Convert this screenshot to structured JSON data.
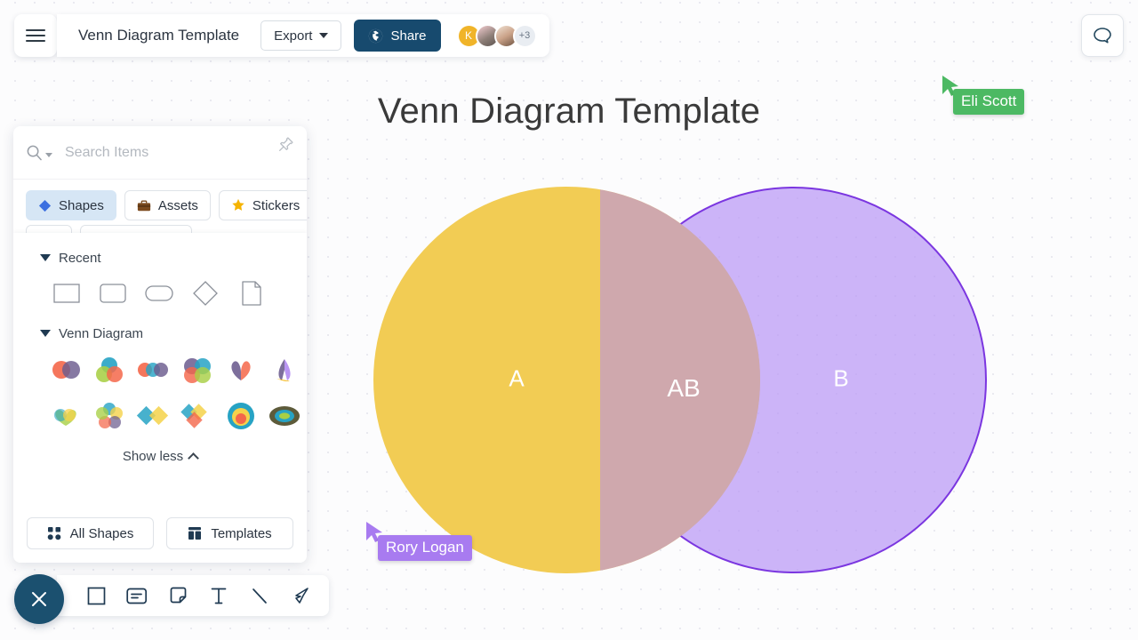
{
  "header": {
    "menu_icon": "hamburger-menu-icon",
    "doc_title": "Venn Diagram Template",
    "export_label": "Export",
    "share_label": "Share",
    "share_icon": "globe-icon",
    "comment_icon": "speech-bubble-icon",
    "avatars": [
      {
        "name": "avatar-k",
        "initial": "K",
        "kind": "initial"
      },
      {
        "name": "avatar-photo-1",
        "initial": "",
        "kind": "photo"
      },
      {
        "name": "avatar-photo-2",
        "initial": "",
        "kind": "photo"
      },
      {
        "name": "avatar-overflow",
        "initial": "+3",
        "kind": "count"
      }
    ],
    "colors": {
      "share_bg": "#174a6e",
      "avatar_k_bg": "#f0b429"
    }
  },
  "panel": {
    "search": {
      "placeholder": "Search Items",
      "value": "",
      "icon": "search-icon",
      "pin_icon": "pin-icon"
    },
    "tabs": [
      {
        "label": "Shapes",
        "icon": "blue-diamond-icon",
        "active": true
      },
      {
        "label": "Assets",
        "icon": "briefcase-icon",
        "active": false
      },
      {
        "label": "Stickers",
        "icon": "star-icon",
        "active": false
      }
    ],
    "groups": [
      {
        "title": "Recent",
        "items": [
          {
            "name": "rectangle-shape"
          },
          {
            "name": "rounded-rectangle-shape"
          },
          {
            "name": "pill-shape"
          },
          {
            "name": "diamond-shape"
          },
          {
            "name": "document-shape"
          }
        ]
      },
      {
        "title": "Venn Diagram",
        "items": [
          {
            "name": "venn-2-circle"
          },
          {
            "name": "venn-3-circle"
          },
          {
            "name": "venn-3-inline"
          },
          {
            "name": "venn-4-circle"
          },
          {
            "name": "venn-2-petal"
          },
          {
            "name": "venn-3-petal"
          },
          {
            "name": "venn-heart-3"
          },
          {
            "name": "venn-flower-6"
          },
          {
            "name": "venn-2-diamond"
          },
          {
            "name": "venn-3-diamond"
          },
          {
            "name": "venn-concentric-circle"
          },
          {
            "name": "venn-concentric-oval"
          }
        ]
      }
    ],
    "show_less_label": "Show less",
    "footer": [
      {
        "label": "All Shapes",
        "icon": "grid-dots-icon"
      },
      {
        "label": "Templates",
        "icon": "layout-icon"
      }
    ]
  },
  "canvas": {
    "board_title": "Venn Diagram Template",
    "venn": {
      "circle_a": {
        "label": "A",
        "fill": "#f2cc54"
      },
      "circle_b": {
        "label": "B",
        "fill": "#ba98f5",
        "stroke": "#7b36e0"
      },
      "intersection": {
        "label": "AB",
        "fill": "#cfa8ad"
      }
    },
    "cursors": [
      {
        "name": "Eli Scott",
        "color": "#4cb963"
      },
      {
        "name": "Rory Logan",
        "color": "#a87bf0"
      }
    ]
  },
  "toolbar": {
    "close_icon": "close-x-icon",
    "tools": [
      {
        "name": "square-tool",
        "icon": "square-icon"
      },
      {
        "name": "card-tool",
        "icon": "card-icon"
      },
      {
        "name": "sticky-note-tool",
        "icon": "sticky-note-icon"
      },
      {
        "name": "text-tool",
        "icon": "text-t-icon"
      },
      {
        "name": "line-tool",
        "icon": "line-icon"
      },
      {
        "name": "pen-tool",
        "icon": "pen-icon"
      }
    ]
  }
}
